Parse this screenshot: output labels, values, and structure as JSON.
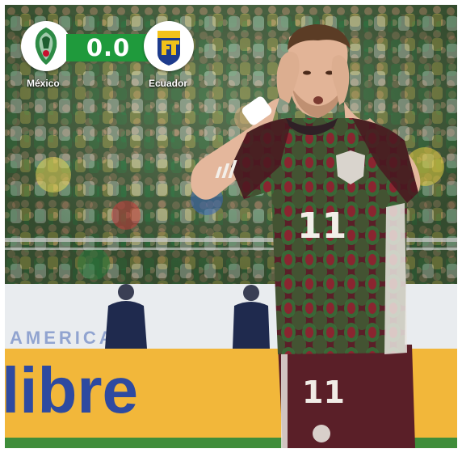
{
  "scoreboard": {
    "home_team": "México",
    "away_team": "Ecuador",
    "score": "0.0",
    "home_logo": "mexico-crest-icon",
    "away_logo": "ecuador-federation-icon"
  },
  "photo": {
    "ad_board_text": "libre",
    "banner_text": "AMERICA",
    "jersey_number": "11",
    "shorts_number": "11",
    "jersey_brand": "adidas"
  },
  "colors": {
    "score_green": "#1f9a3c",
    "jersey_maroon": "#5a1f28",
    "ad_board_yellow": "#f2b73a",
    "ad_text_blue": "#2e4aa0",
    "ecuador_blue": "#1d3b8c",
    "ecuador_yellow": "#f2c21a"
  }
}
